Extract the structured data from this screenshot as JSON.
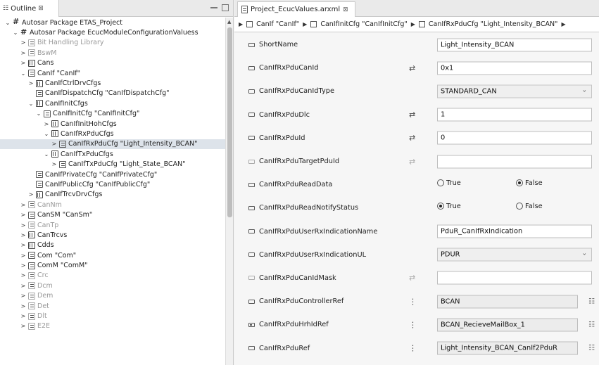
{
  "outline": {
    "tab_label": "Outline",
    "tree": [
      {
        "indent": 0,
        "arrow": "⌄",
        "icon": "pkg",
        "label": "Autosar Package ETAS_Project"
      },
      {
        "indent": 1,
        "arrow": "⌄",
        "icon": "pkg",
        "label": "Autosar Package EcucModuleConfigurationValuess"
      },
      {
        "indent": 2,
        "arrow": ">",
        "icon": "list",
        "label": "Bit Handling Library",
        "muted": true
      },
      {
        "indent": 2,
        "arrow": ">",
        "icon": "list",
        "label": "BswM",
        "muted": true
      },
      {
        "indent": 2,
        "arrow": ">",
        "icon": "grid",
        "label": "Cans"
      },
      {
        "indent": 2,
        "arrow": "⌄",
        "icon": "list",
        "label": "CanIf \"CanIf\""
      },
      {
        "indent": 3,
        "arrow": ">",
        "icon": "grid",
        "label": "CanIfCtrlDrvCfgs"
      },
      {
        "indent": 3,
        "arrow": "",
        "icon": "list",
        "label": "CanIfDispatchCfg \"CanIfDispatchCfg\""
      },
      {
        "indent": 3,
        "arrow": "⌄",
        "icon": "grid",
        "label": "CanIfInitCfgs"
      },
      {
        "indent": 4,
        "arrow": "⌄",
        "icon": "list",
        "label": "CanIfInitCfg \"CanIfInitCfg\""
      },
      {
        "indent": 5,
        "arrow": ">",
        "icon": "grid",
        "label": "CanIfInitHohCfgs"
      },
      {
        "indent": 5,
        "arrow": "⌄",
        "icon": "grid",
        "label": "CanIfRxPduCfgs"
      },
      {
        "indent": 6,
        "arrow": ">",
        "icon": "list",
        "label": "CanIfRxPduCfg \"Light_Intensity_BCAN\"",
        "selected": true
      },
      {
        "indent": 5,
        "arrow": "⌄",
        "icon": "grid",
        "label": "CanIfTxPduCfgs"
      },
      {
        "indent": 6,
        "arrow": ">",
        "icon": "list",
        "label": "CanIfTxPduCfg \"Light_State_BCAN\""
      },
      {
        "indent": 3,
        "arrow": "",
        "icon": "list",
        "label": "CanIfPrivateCfg \"CanIfPrivateCfg\""
      },
      {
        "indent": 3,
        "arrow": "",
        "icon": "list",
        "label": "CanIfPublicCfg \"CanIfPublicCfg\""
      },
      {
        "indent": 3,
        "arrow": ">",
        "icon": "grid",
        "label": "CanIfTrcvDrvCfgs"
      },
      {
        "indent": 2,
        "arrow": ">",
        "icon": "list",
        "label": "CanNm",
        "muted": true
      },
      {
        "indent": 2,
        "arrow": ">",
        "icon": "list",
        "label": "CanSM \"CanSm\""
      },
      {
        "indent": 2,
        "arrow": ">",
        "icon": "list",
        "label": "CanTp",
        "muted": true
      },
      {
        "indent": 2,
        "arrow": ">",
        "icon": "grid",
        "label": "CanTrcvs"
      },
      {
        "indent": 2,
        "arrow": ">",
        "icon": "grid",
        "label": "Cdds"
      },
      {
        "indent": 2,
        "arrow": ">",
        "icon": "list",
        "label": "Com \"Com\""
      },
      {
        "indent": 2,
        "arrow": ">",
        "icon": "list",
        "label": "ComM \"ComM\""
      },
      {
        "indent": 2,
        "arrow": ">",
        "icon": "list",
        "label": "Crc",
        "muted": true
      },
      {
        "indent": 2,
        "arrow": ">",
        "icon": "list",
        "label": "Dcm",
        "muted": true
      },
      {
        "indent": 2,
        "arrow": ">",
        "icon": "list",
        "label": "Dem",
        "muted": true
      },
      {
        "indent": 2,
        "arrow": ">",
        "icon": "list",
        "label": "Det",
        "muted": true
      },
      {
        "indent": 2,
        "arrow": ">",
        "icon": "list",
        "label": "Dlt",
        "muted": true
      },
      {
        "indent": 2,
        "arrow": ">",
        "icon": "list",
        "label": "E2E",
        "muted": true
      }
    ]
  },
  "editor": {
    "tab_label": "Project_EcucValues.arxml",
    "breadcrumb": [
      "CanIf \"CanIf\"",
      "CanIfInitCfg \"CanIfInitCfg\"",
      "CanIfRxPduCfg \"Light_Intensity_BCAN\""
    ],
    "properties": [
      {
        "label": "ShortName",
        "kind": "text",
        "value": "Light_Intensity_BCAN",
        "icon": ""
      },
      {
        "label": "CanIfRxPduCanId",
        "kind": "text",
        "value": "0x1",
        "icon": "overwrite"
      },
      {
        "label": "CanIfRxPduCanIdType",
        "kind": "select",
        "value": "STANDARD_CAN",
        "icon": ""
      },
      {
        "label": "CanIfRxPduDlc",
        "kind": "text",
        "value": "1",
        "icon": "overwrite"
      },
      {
        "label": "CanIfRxPduId",
        "kind": "text",
        "value": "0",
        "icon": "overwrite"
      },
      {
        "label": "CanIfRxPduTargetPduId",
        "kind": "text",
        "value": "",
        "icon": "overwrite-light",
        "light": true
      },
      {
        "label": "CanIfRxPduReadData",
        "kind": "radio",
        "options": [
          "True",
          "False"
        ],
        "selected": "False",
        "icon": ""
      },
      {
        "label": "CanIfRxPduReadNotifyStatus",
        "kind": "radio",
        "options": [
          "True",
          "False"
        ],
        "selected": "True",
        "icon": ""
      },
      {
        "label": "CanIfRxPduUserRxIndicationName",
        "kind": "text",
        "value": "PduR_CanIfRxIndication",
        "icon": ""
      },
      {
        "label": "CanIfRxPduUserRxIndicationUL",
        "kind": "select",
        "value": "PDUR",
        "icon": ""
      },
      {
        "label": "CanIfRxPduCanIdMask",
        "kind": "text",
        "value": "",
        "icon": "overwrite-light",
        "light": true
      },
      {
        "label": "CanIfRxPduControllerRef",
        "kind": "ref",
        "value": "BCAN",
        "icon": "ref"
      },
      {
        "label": "CanIfRxPduHrhIdRef",
        "kind": "ref",
        "value": "BCAN_RecieveMailBox_1",
        "icon": "ref",
        "reficon": true
      },
      {
        "label": "CanIfRxPduRef",
        "kind": "ref",
        "value": "Light_Intensity_BCAN_CanIf2PduR",
        "icon": "ref"
      }
    ]
  }
}
